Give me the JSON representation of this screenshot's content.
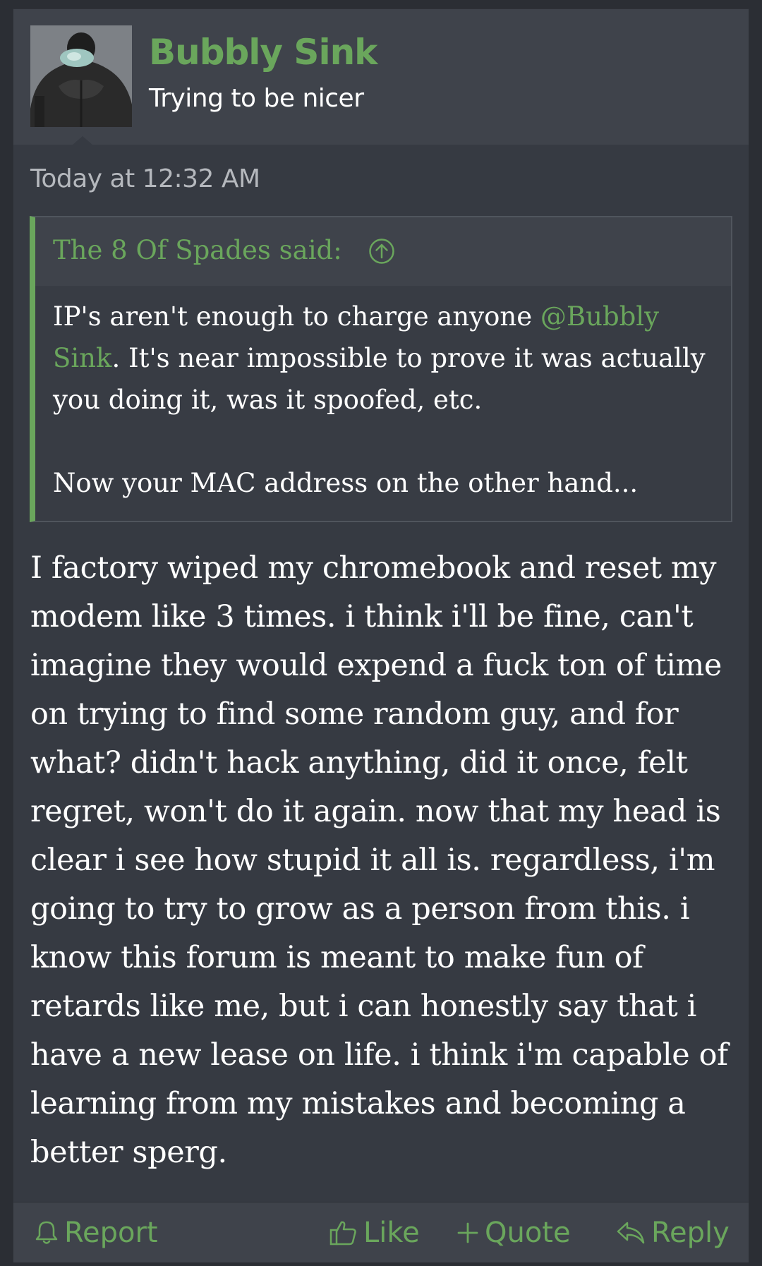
{
  "colors": {
    "accent": "#6aa65c",
    "text": "#ffffff",
    "muted": "#b5b8bd",
    "panel": "#363a42",
    "header": "#3f434b"
  },
  "user": {
    "name": "Bubbly Sink",
    "title": "Trying to be nicer",
    "avatar_icon": "avatar-image"
  },
  "post": {
    "timestamp": "Today at 12:32 AM",
    "quote": {
      "author_label": "The 8 Of Spades said:",
      "jump_icon": "arrow-up-circle-icon",
      "text_before_mention": "IP's aren't enough to charge anyone ",
      "mention": "@Bubbly Sink",
      "text_after_mention": ". It's near impossible to prove it was actually you doing it, was it spoofed, etc.",
      "second_paragraph": "Now your MAC address on the other hand..."
    },
    "message": "I factory wiped my chromebook and reset my modem like 3 times. i think i'll be fine, can't imagine they would expend a fuck ton of time on trying to find some random guy, and for what? didn't hack anything, did it once, felt regret, won't do it again. now that my head is clear i see how stupid it all is. regardless, i'm going to try to grow as a person from this. i know this forum is meant to make fun of retards like me, but i can honestly say that i have a new lease on life. i think i'm capable of learning from my mistakes and becoming a better sperg."
  },
  "actions": {
    "report": {
      "label": "Report",
      "icon": "bell-icon"
    },
    "like": {
      "label": "Like",
      "icon": "thumbs-up-icon"
    },
    "quote": {
      "label": "Quote",
      "icon": "plus-icon"
    },
    "reply": {
      "label": "Reply",
      "icon": "reply-icon"
    }
  }
}
